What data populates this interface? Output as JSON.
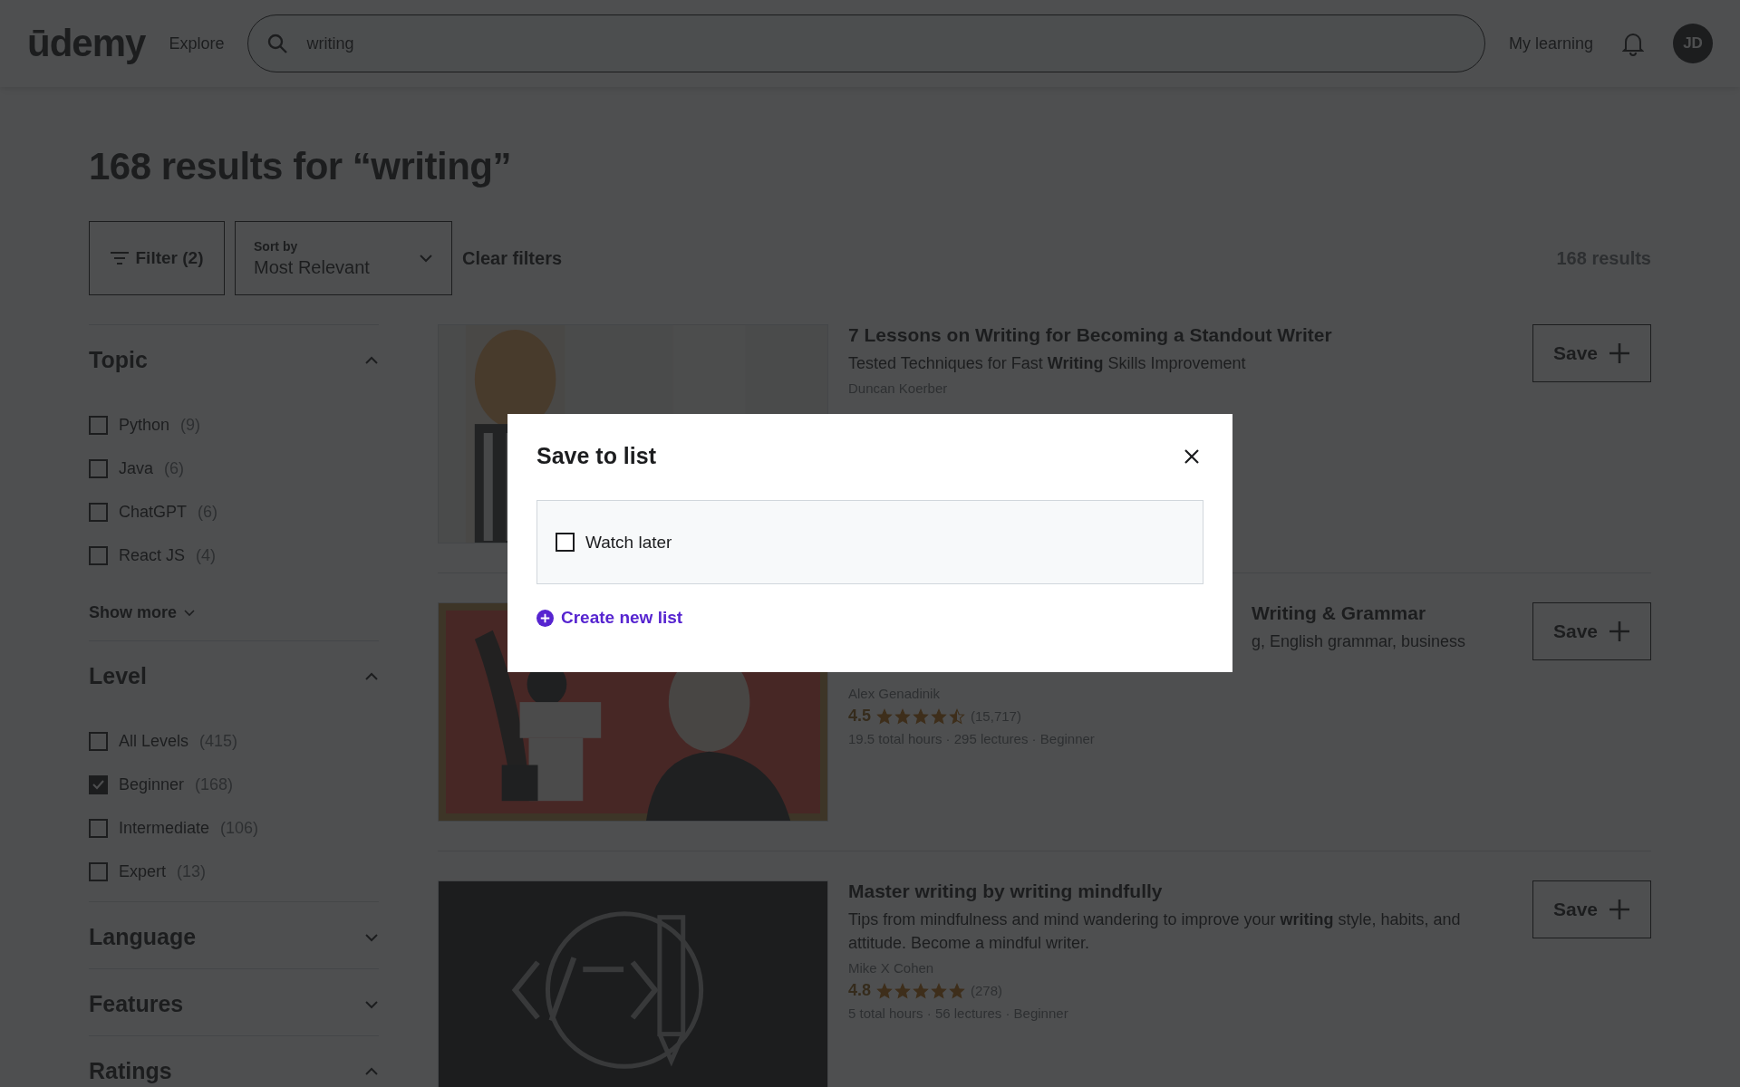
{
  "header": {
    "logo": "ūdemy",
    "explore": "Explore",
    "search": {
      "value": "writing"
    },
    "my_learning": "My learning",
    "avatar": "JD"
  },
  "heading": "168 results for “writing”",
  "toolbar": {
    "filter": "Filter (2)",
    "sort_label": "Sort by",
    "sort_value": "Most Relevant",
    "clear": "Clear filters",
    "count": "168 results"
  },
  "sidebar": [
    {
      "title": "Topic",
      "expanded": true,
      "items": [
        {
          "label": "Python",
          "count": "(9)",
          "checked": false
        },
        {
          "label": "Java",
          "count": "(6)",
          "checked": false
        },
        {
          "label": "ChatGPT",
          "count": "(6)",
          "checked": false
        },
        {
          "label": "React JS",
          "count": "(4)",
          "checked": false
        }
      ],
      "show_more": "Show more"
    },
    {
      "title": "Level",
      "expanded": true,
      "items": [
        {
          "label": "All Levels",
          "count": "(415)",
          "checked": false
        },
        {
          "label": "Beginner",
          "count": "(168)",
          "checked": true
        },
        {
          "label": "Intermediate",
          "count": "(106)",
          "checked": false
        },
        {
          "label": "Expert",
          "count": "(13)",
          "checked": false
        }
      ]
    },
    {
      "title": "Language",
      "expanded": false
    },
    {
      "title": "Features",
      "expanded": false
    },
    {
      "title": "Ratings",
      "expanded": true
    }
  ],
  "courses": [
    {
      "title": "7 Lessons on Writing for Becoming a Standout Writer",
      "subtitle": "Tested Techniques for Fast **Writing** Skills Improvement",
      "author": "Duncan Koerber",
      "save": "Save"
    },
    {
      "title": "Writing & Grammar",
      "subtitle": "g, English grammar, business",
      "author": "Alex Genadinik",
      "rating": "4.5",
      "stars": 4.5,
      "reviews": "(15,717)",
      "meta": "19.5 total hours · 295 lectures · Beginner",
      "save": "Save",
      "covered": true
    },
    {
      "title": "Master writing by writing mindfully",
      "subtitle": "Tips from mindfulness and mind wandering to improve your **writing** style, habits, and attitude. Become a mindful writer.",
      "author": "Mike X Cohen",
      "rating": "4.8",
      "stars": 5,
      "reviews": "(278)",
      "meta": "5 total hours · 56 lectures · Beginner",
      "save": "Save"
    }
  ],
  "modal": {
    "title": "Save to list",
    "lists": [
      {
        "label": "Watch later",
        "checked": false
      }
    ],
    "create": "Create new list"
  }
}
